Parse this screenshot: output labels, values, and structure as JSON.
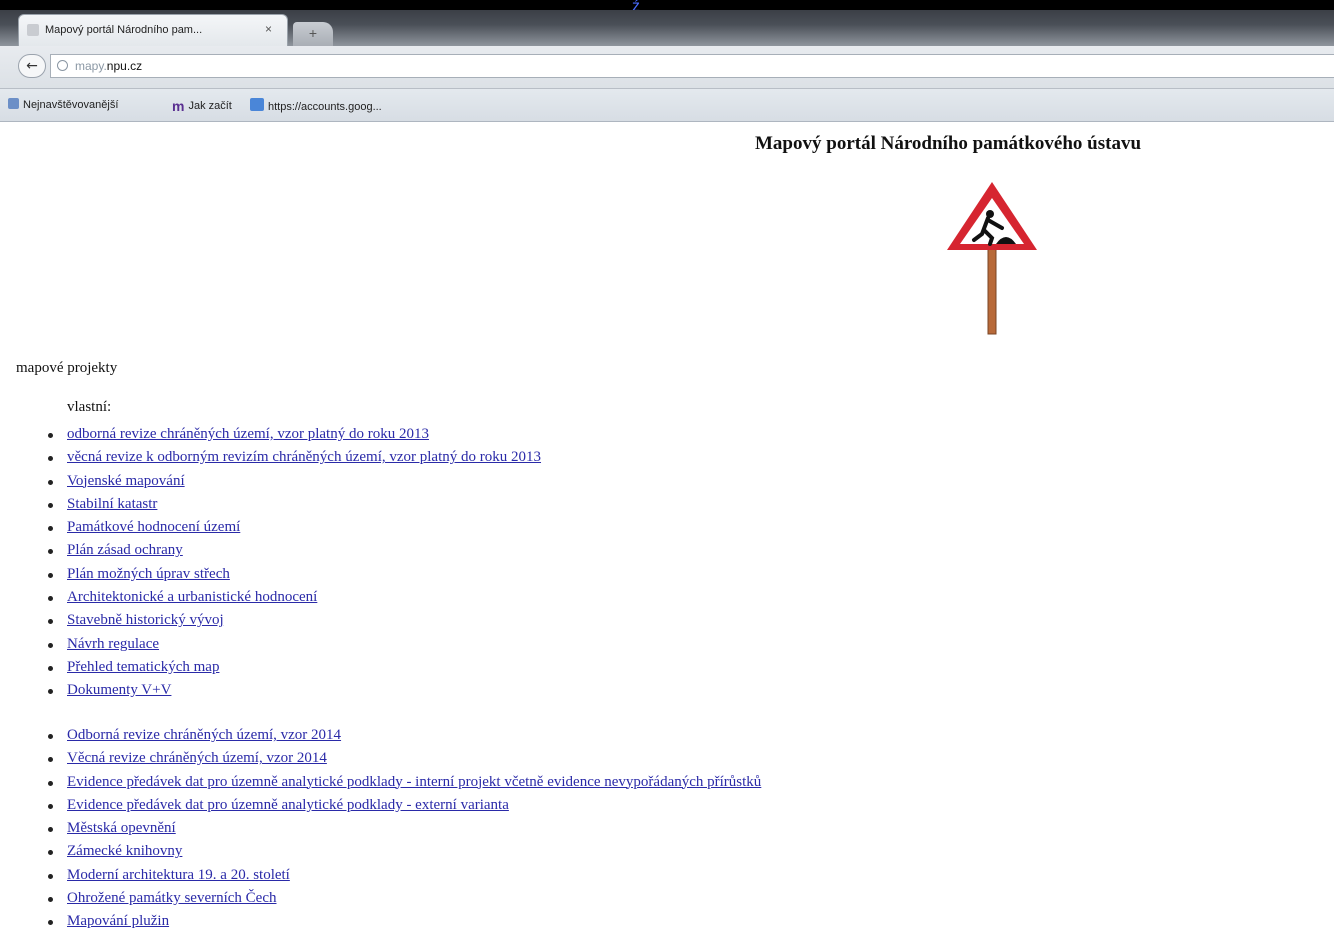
{
  "browser": {
    "tab_title": "Mapový portál Národního pam...",
    "tab_close": "×",
    "new_tab": "+",
    "top_glyph": "ź",
    "back": "←",
    "url_sub": "mapy.",
    "url_main": "npu.cz",
    "bookmarks": [
      {
        "icon": "bookmark-icon",
        "label": "Nejnavštěvovanější"
      },
      {
        "icon": "m-logo-icon",
        "glyph": "m",
        "label": "Jak začít"
      },
      {
        "icon": "google-icon",
        "label": "https://accounts.goog..."
      }
    ]
  },
  "page": {
    "title": "Mapový portál Národního památkového ústavu",
    "section_label": "mapové projekty",
    "sub_label": "vlastní:",
    "list1": [
      "odborná revize chráněných území, vzor platný do roku 2013",
      "věcná revize k odborným revizím chráněných území, vzor platný do roku 2013",
      "Vojenské mapování",
      "Stabilní katastr",
      "Památkové hodnocení území",
      "Plán zásad ochrany",
      "Plán možných úprav střech",
      "Architektonické a urbanistické hodnocení",
      "Stavebně historický vývoj",
      "Návrh regulace",
      "Přehled tematických map",
      "Dokumenty V+V"
    ],
    "list2": [
      "Odborná revize chráněných území, vzor 2014",
      "Věcná revize chráněných území, vzor 2014",
      "Evidence předávek dat pro územně analytické podklady - interní projekt včetně evidence nevypořádaných přírůstků",
      "Evidence předávek dat pro územně analytické podklady - externí varianta",
      "Městská opevnění",
      "Zámecké knihovny",
      "Moderní architektura 19. a 20. století",
      "Ohrožené památky severních Čech",
      "Mapování plužin"
    ]
  },
  "colors": {
    "link": "#2a2aa8",
    "sign_red": "#d62530",
    "sign_post": "#b86a3a"
  }
}
